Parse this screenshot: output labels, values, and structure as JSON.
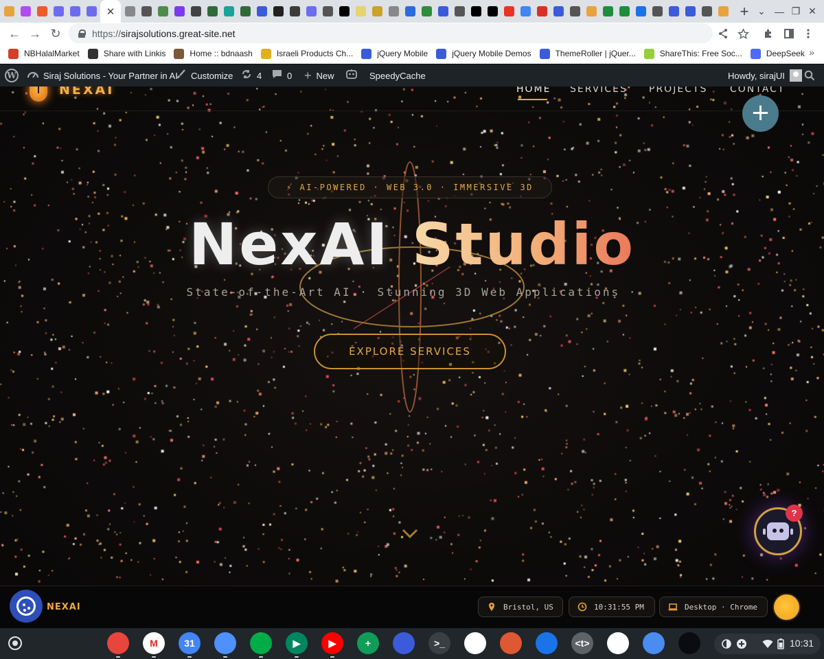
{
  "tabs": {
    "favicon_colors": [
      "#e8a33b",
      "#b24cf0",
      "#f05a28",
      "#6c6cf0",
      "#6c6cf0",
      "#6c6cf0",
      "#888888",
      "#555555",
      "#4c8c4c",
      "#7c3aed",
      "#444444",
      "#2f6b3a",
      "#1aa39a",
      "#2f6b3a",
      "#3b5bdb",
      "#222222",
      "#3b3b3b",
      "#6c6cf0",
      "#555555",
      "#000000",
      "#e7d36b",
      "#c9a227",
      "#888888",
      "#2b6cde",
      "#2f8c3a",
      "#3b5bdb",
      "#555555",
      "#000000",
      "#000000",
      "#ea3323",
      "#4285f4",
      "#d93025",
      "#3b5bdb",
      "#555555",
      "#e8a33b",
      "#1e8e3e",
      "#1e8e3e",
      "#1a73e8",
      "#555555",
      "#3b5bdb",
      "#3b5bdb",
      "#555555",
      "#e8a33b"
    ],
    "active_close": "✕",
    "new_tab": "+"
  },
  "window": {
    "minimize": "⌄",
    "restore": "—",
    "maximize": "❐",
    "close": "✕"
  },
  "toolbar": {
    "back": "←",
    "forward": "→",
    "reload": "↻",
    "url_scheme": "https://",
    "url_host": "sirajsolutions.great-site.net",
    "share_icon": "share-icon",
    "star_icon": "star-icon"
  },
  "bookmarks": [
    {
      "label": "NBHalalMarket",
      "color": "#d23f2a"
    },
    {
      "label": "Share with Linkis",
      "color": "#333333"
    },
    {
      "label": "Home :: bdnaash",
      "color": "#7a5a3a"
    },
    {
      "label": "Israeli Products Ch...",
      "color": "#e0b020"
    },
    {
      "label": "jQuery Mobile",
      "color": "#3b5bdb"
    },
    {
      "label": "jQuery Mobile Demos",
      "color": "#3b5bdb"
    },
    {
      "label": "ThemeRoller | jQuer...",
      "color": "#3b5bdb"
    },
    {
      "label": "ShareThis: Free Soc...",
      "color": "#95d03a"
    },
    {
      "label": "DeepSeek",
      "color": "#4d6bfe"
    }
  ],
  "bookmarks_more": "»",
  "wp_admin": {
    "site_name": "Siraj Solutions - Your Partner in AI",
    "customize": "Customize",
    "updates_count": "4",
    "comments_count": "0",
    "new_label": "New",
    "speedycache": "SpeedyCache",
    "howdy": "Howdy, sirajUI"
  },
  "site": {
    "brand": "NEXAI",
    "nav": [
      "HOME",
      "SERVICES",
      "PROJECTS",
      "CONTACT"
    ],
    "fab": "+",
    "pill_text": "⚡ AI-POWERED · WEB 3.0 · IMMERSIVE 3D",
    "title_word1": "NexAI",
    "title_word2": "Studio",
    "subtitle": "State-of-the-Art AI · Stunning 3D Web Applications ·",
    "cta": "EXPLORE SERVICES",
    "bot_badge": "?",
    "footer_brand": "NEXAI",
    "location": "Bristol, US",
    "time": "10:31:55 PM",
    "device": "Desktop · Chrome",
    "accent": "#e3a947"
  },
  "shelf": {
    "apps": [
      {
        "name": "chrome",
        "color": "#e8453c",
        "glyph": ""
      },
      {
        "name": "gmail",
        "color": "#ffffff",
        "glyph": "M"
      },
      {
        "name": "calendar",
        "color": "#4285f4",
        "glyph": "31"
      },
      {
        "name": "files",
        "color": "#4d90fe",
        "glyph": ""
      },
      {
        "name": "meet",
        "color": "#00ac47",
        "glyph": ""
      },
      {
        "name": "play-store",
        "color": "#01875f",
        "glyph": "▶"
      },
      {
        "name": "youtube",
        "color": "#ff0000",
        "glyph": "▶"
      },
      {
        "name": "sheets",
        "color": "#0f9d58",
        "glyph": "+"
      },
      {
        "name": "app-blue",
        "color": "#3b5bdb",
        "glyph": ""
      },
      {
        "name": "terminal",
        "color": "#3a3f44",
        "glyph": ">_"
      },
      {
        "name": "maps",
        "color": "#ffffff",
        "glyph": ""
      },
      {
        "name": "duckduckgo",
        "color": "#de5833",
        "glyph": ""
      },
      {
        "name": "passwords",
        "color": "#1a73e8",
        "glyph": ""
      },
      {
        "name": "text",
        "color": "#5f6368",
        "glyph": "<t>"
      },
      {
        "name": "drive",
        "color": "#ffffff",
        "glyph": ""
      },
      {
        "name": "app-sky",
        "color": "#4a8cf0",
        "glyph": ""
      },
      {
        "name": "app-dark",
        "color": "#0b0c10",
        "glyph": ""
      }
    ],
    "clock": "10:31"
  }
}
